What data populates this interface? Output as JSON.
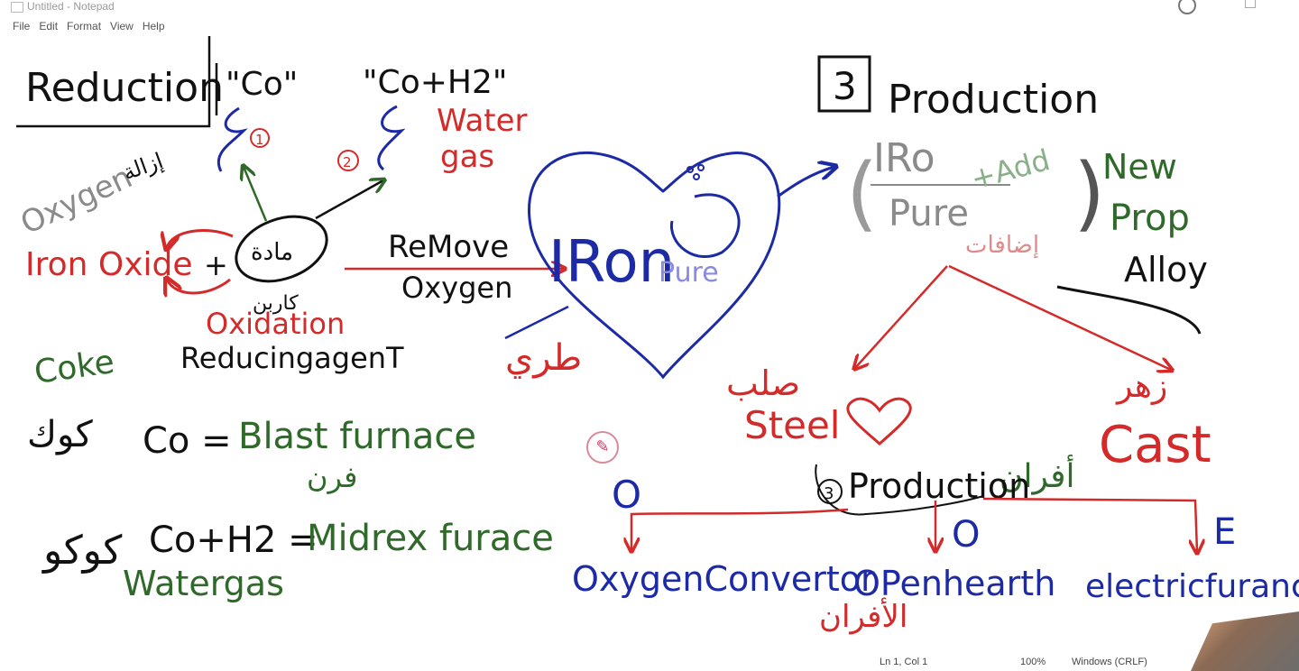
{
  "window": {
    "title": "Untitled - Notepad"
  },
  "menu": {
    "file": "File",
    "edit": "Edit",
    "format": "Format",
    "view": "View",
    "help": "Help"
  },
  "status": {
    "position": "Ln 1, Col 1",
    "zoom": "100%",
    "encoding": "Windows (CRLF)"
  },
  "colors": {
    "black": "#111111",
    "red": "#d42a2a",
    "green": "#2f6a2a",
    "blue": "#1c2aa6",
    "gray": "#8a8a8a"
  },
  "left": {
    "title": "Reduction",
    "co": "\"Co\"",
    "co_h2": "\"Co+H2\"",
    "num1": "1",
    "num2": "2",
    "water": "Water",
    "gas": "gas",
    "oxygen": "Oxygen",
    "izala": "إزالة",
    "iron_oxide": "Iron Oxide",
    "plus": "+",
    "circle_word": "مادة",
    "kareem": "كاربن",
    "oxidation": "Oxidation",
    "reducing_agent": "ReducingagenT",
    "remove": "ReMove",
    "remove_oxygen": "Oxygen",
    "coke": "Coke",
    "coke_ar": "كوك",
    "co_eq": "Co =",
    "blast": "Blast furnace",
    "blast_ar": "فرن",
    "coh2_eq": "Co+H2 =",
    "midrex": "Midrex furace",
    "watergas": "Watergas",
    "watergas_ar": "كوكو"
  },
  "center": {
    "iron": "IRon",
    "pure": "Pure",
    "tari": "طري"
  },
  "right": {
    "box_num": "3",
    "production": "Production",
    "iron_top": "IRo",
    "pure": "Pure",
    "add": "+Add",
    "idafat": "إضافات",
    "new": "New",
    "prop": "Prop",
    "alloy": "Alloy",
    "solb": "صلب",
    "steel": "Steel",
    "zahr": "زهر",
    "cast": "Cast",
    "afran": "أفران",
    "prod_num": "3",
    "production2": "Production",
    "o1": "O",
    "o2": "O",
    "e": "E",
    "oxygen_conv": "OxygenConvertor",
    "open_hearth": "OPenhearth",
    "electric": "electricfurance",
    "alafran": "الأفران"
  }
}
